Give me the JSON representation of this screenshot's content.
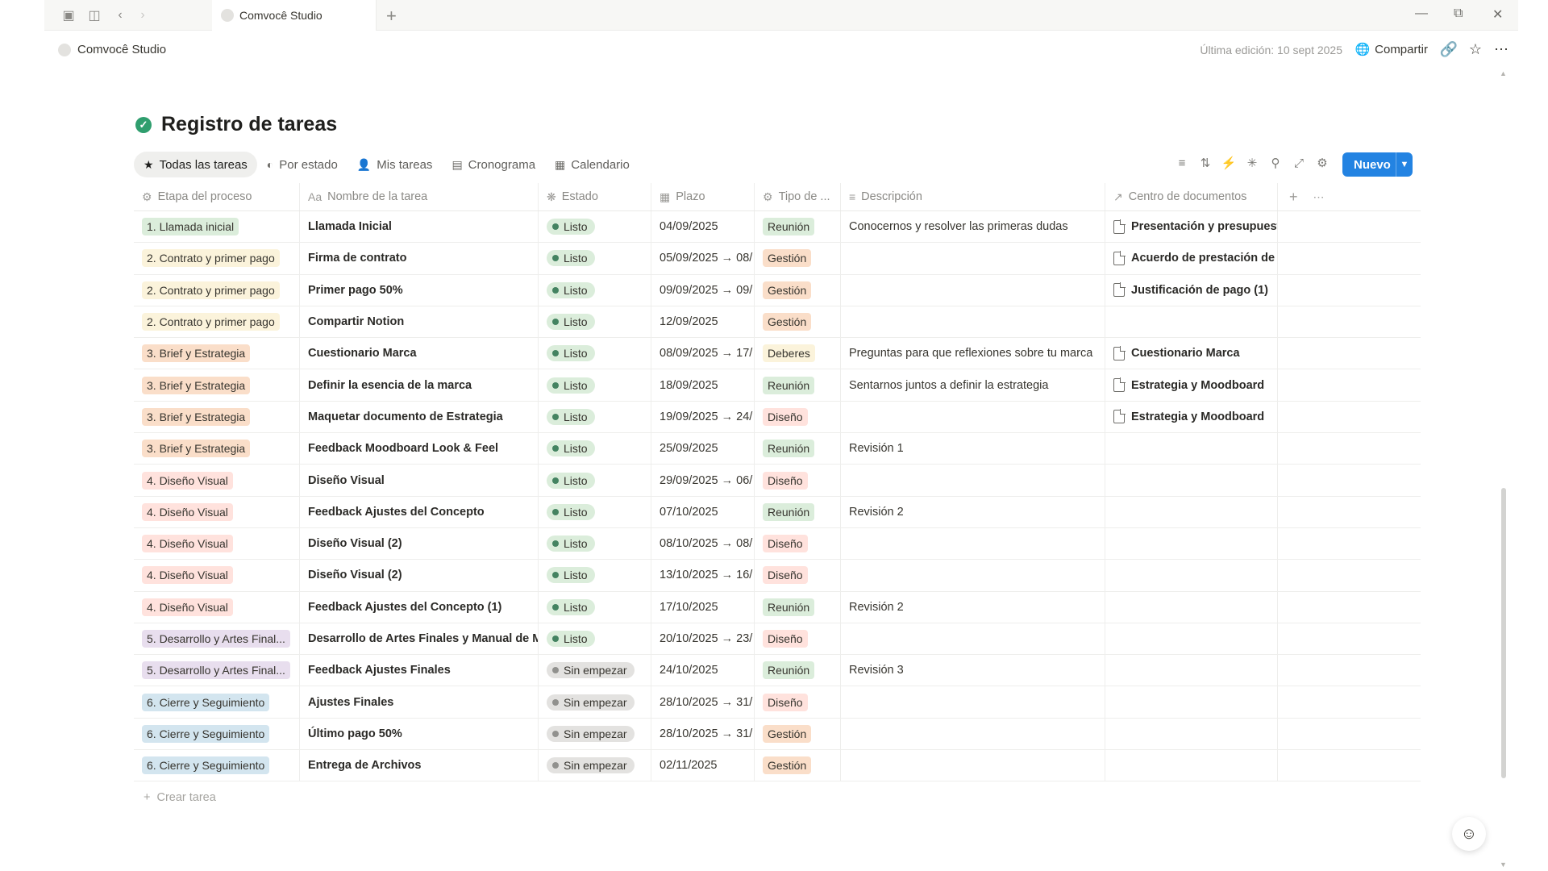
{
  "browser": {
    "tab_title": "Comvocê Studio",
    "new_tab": "+"
  },
  "topbar": {
    "breadcrumb": "Comvocê Studio",
    "last_edit": "Última edición: 10 sept 2025",
    "share_label": "Compartir"
  },
  "page": {
    "title": "Registro de tareas"
  },
  "views": [
    {
      "label": "Todas las tareas",
      "icon": "star-icon"
    },
    {
      "label": "Por estado",
      "icon": "status-icon"
    },
    {
      "label": "Mis tareas",
      "icon": "person-icon"
    },
    {
      "label": "Cronograma",
      "icon": "timeline-icon"
    },
    {
      "label": "Calendario",
      "icon": "calendar-icon"
    }
  ],
  "toolbar": {
    "new_label": "Nuevo"
  },
  "columns": [
    "Etapa del proceso",
    "Nombre de la tarea",
    "Estado",
    "Plazo",
    "Tipo de ...",
    "Descripción",
    "Centro de documentos"
  ],
  "colors": {
    "stage1": "#dbeddb",
    "stage2": "#fbf3db",
    "stage3": "#fadec9",
    "stage4": "#ffe2dd",
    "stage5": "#e8deee",
    "stage6": "#d3e5ef",
    "reunion": "#dbeddb",
    "gestion": "#fadec9",
    "deberes": "#fbf3db",
    "diseno": "#ffe2dd",
    "listo_bg": "#dbeddb",
    "listo_dot": "#448361",
    "sin_bg": "#e3e2e0",
    "sin_dot": "#91918e",
    "accent": "#2383e2"
  },
  "rows": [
    {
      "stage": "1. Llamada inicial",
      "name": "Llamada Inicial",
      "status": "Listo",
      "date": "04/09/2025",
      "type": "Reunión",
      "desc": "Conocernos y resolver las primeras dudas",
      "doc": "Presentación y presupuest"
    },
    {
      "stage": "2. Contrato y primer pago",
      "name": "Firma de contrato",
      "status": "Listo",
      "date": "05/09/2025 → 08/",
      "type": "Gestión",
      "desc": "",
      "doc": "Acuerdo de prestación de s"
    },
    {
      "stage": "2. Contrato y primer pago",
      "name": "Primer pago 50%",
      "status": "Listo",
      "date": "09/09/2025 → 09/",
      "type": "Gestión",
      "desc": "",
      "doc": "Justificación de pago (1)"
    },
    {
      "stage": "2. Contrato y primer pago",
      "name": "Compartir Notion",
      "status": "Listo",
      "date": "12/09/2025",
      "type": "Gestión",
      "desc": "",
      "doc": ""
    },
    {
      "stage": "3. Brief y Estrategia",
      "name": "Cuestionario Marca",
      "status": "Listo",
      "date": "08/09/2025 → 17/",
      "type": "Deberes",
      "desc": "Preguntas para que reflexiones sobre tu marca",
      "doc": "Cuestionario Marca"
    },
    {
      "stage": "3. Brief y Estrategia",
      "name": "Definir la esencia de la marca",
      "status": "Listo",
      "date": "18/09/2025",
      "type": "Reunión",
      "desc": "Sentarnos juntos a definir la estrategia",
      "doc": "Estrategia y Moodboard"
    },
    {
      "stage": "3. Brief y Estrategia",
      "name": "Maquetar documento de Estrategia",
      "status": "Listo",
      "date": "19/09/2025 → 24/",
      "type": "Diseño",
      "desc": "",
      "doc": "Estrategia y Moodboard"
    },
    {
      "stage": "3. Brief y Estrategia",
      "name": "Feedback Moodboard Look & Feel",
      "status": "Listo",
      "date": "25/09/2025",
      "type": "Reunión",
      "desc": "Revisión 1",
      "doc": ""
    },
    {
      "stage": "4. Diseño Visual",
      "name": "Diseño Visual",
      "status": "Listo",
      "date": "29/09/2025 → 06/",
      "type": "Diseño",
      "desc": "",
      "doc": ""
    },
    {
      "stage": "4. Diseño Visual",
      "name": "Feedback Ajustes del Concepto",
      "status": "Listo",
      "date": "07/10/2025",
      "type": "Reunión",
      "desc": "Revisión 2",
      "doc": ""
    },
    {
      "stage": "4. Diseño Visual",
      "name": "Diseño Visual (2)",
      "status": "Listo",
      "date": "08/10/2025 → 08/",
      "type": "Diseño",
      "desc": "",
      "doc": ""
    },
    {
      "stage": "4. Diseño Visual",
      "name": "Diseño Visual (2)",
      "status": "Listo",
      "date": "13/10/2025 → 16/",
      "type": "Diseño",
      "desc": "",
      "doc": ""
    },
    {
      "stage": "4. Diseño Visual",
      "name": "Feedback Ajustes del Concepto (1)",
      "status": "Listo",
      "date": "17/10/2025",
      "type": "Reunión",
      "desc": "Revisión 2",
      "doc": ""
    },
    {
      "stage": "5. Desarrollo y Artes Final...",
      "name": "Desarrollo de Artes Finales y Manual de Ma",
      "status": "Listo",
      "date": "20/10/2025 → 23/",
      "type": "Diseño",
      "desc": "",
      "doc": ""
    },
    {
      "stage": "5. Desarrollo y Artes Final...",
      "name": "Feedback Ajustes Finales",
      "status": "Sin empezar",
      "date": "24/10/2025",
      "type": "Reunión",
      "desc": "Revisión 3",
      "doc": ""
    },
    {
      "stage": "6. Cierre y Seguimiento",
      "name": "Ajustes Finales",
      "status": "Sin empezar",
      "date": "28/10/2025 → 31/",
      "type": "Diseño",
      "desc": "",
      "doc": ""
    },
    {
      "stage": "6. Cierre y Seguimiento",
      "name": "Último pago 50%",
      "status": "Sin empezar",
      "date": "28/10/2025 → 31/",
      "type": "Gestión",
      "desc": "",
      "doc": ""
    },
    {
      "stage": "6. Cierre y Seguimiento",
      "name": "Entrega de Archivos",
      "status": "Sin empezar",
      "date": "02/11/2025",
      "type": "Gestión",
      "desc": "",
      "doc": ""
    }
  ],
  "add_row_label": "Crear tarea"
}
